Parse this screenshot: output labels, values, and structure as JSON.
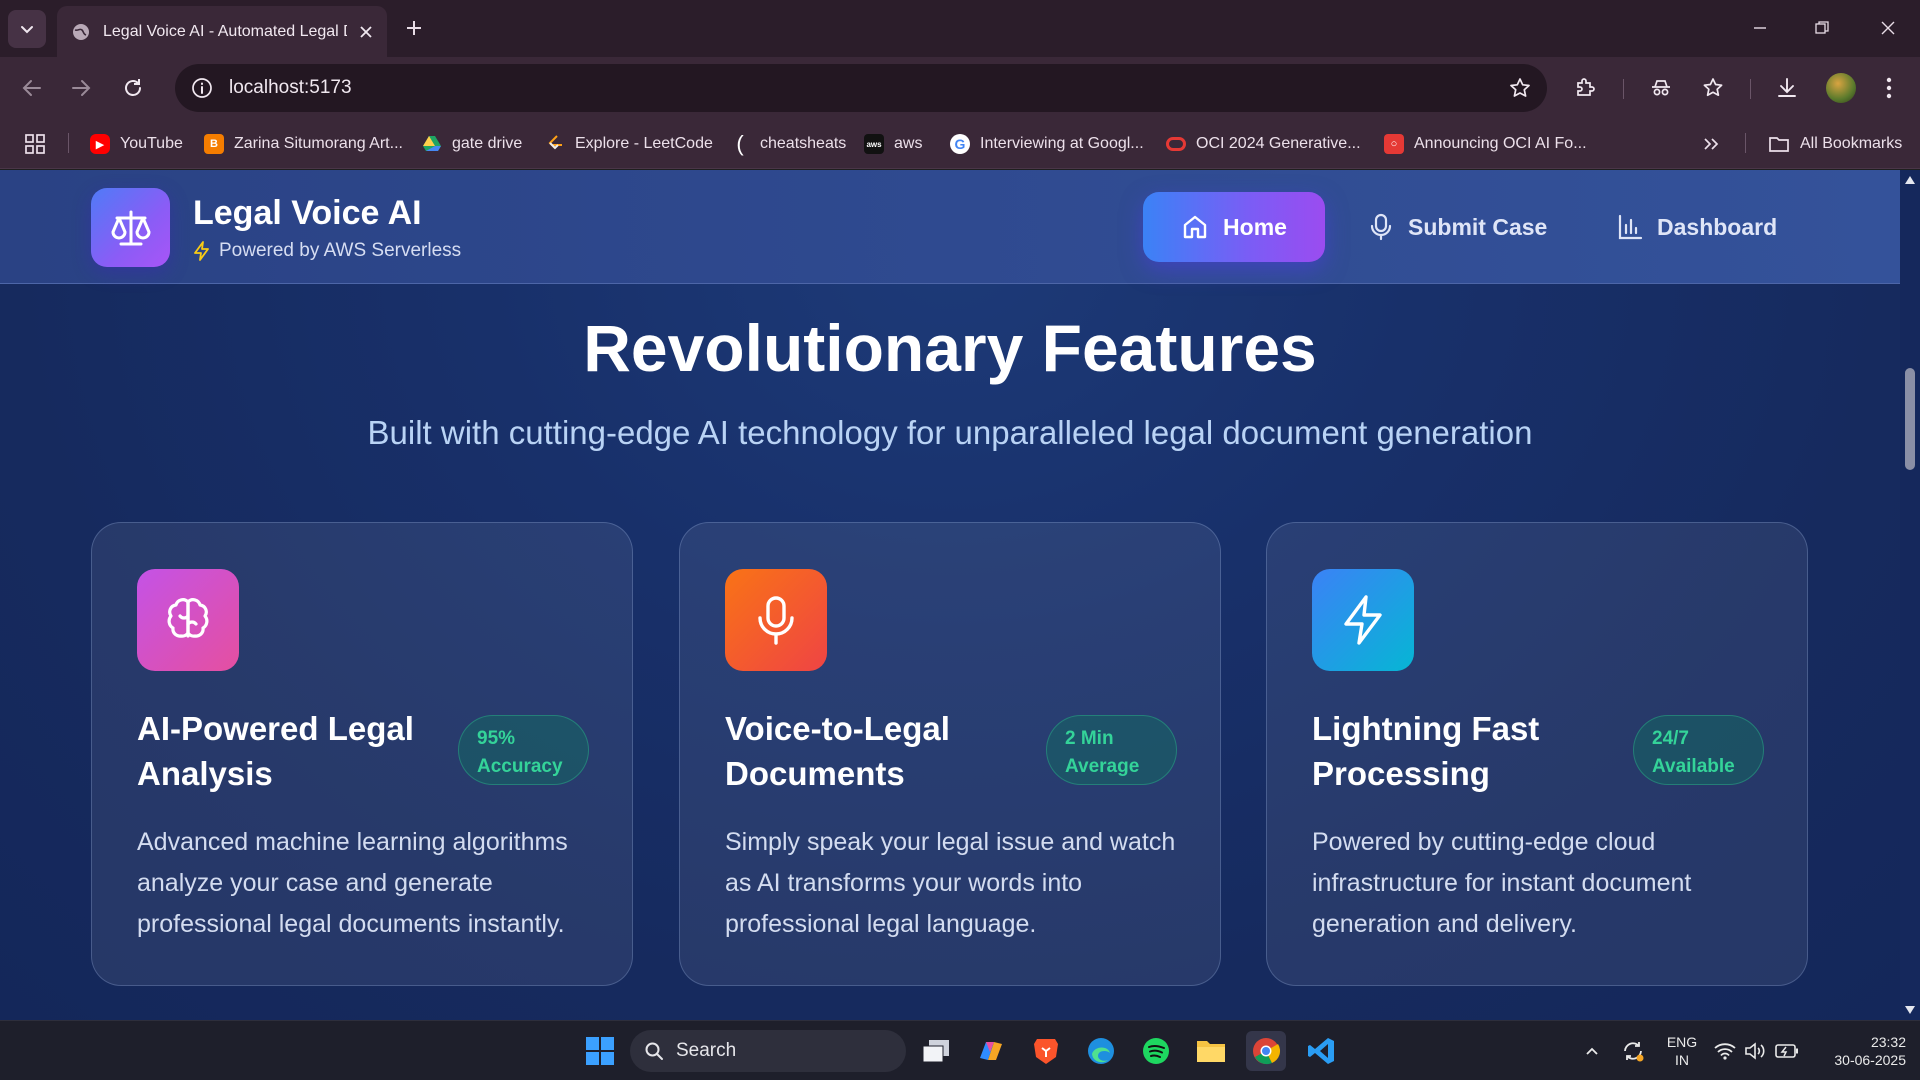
{
  "browser": {
    "tab_title": "Legal Voice AI - Automated Legal D",
    "url": "localhost:5173",
    "bookmarks": [
      {
        "label": "YouTube",
        "icon": "youtube-icon",
        "color": "#ff0000"
      },
      {
        "label": "Zarina Situmorang Art...",
        "icon": "blogger-icon",
        "color": "#f57d00"
      },
      {
        "label": "gate drive",
        "icon": "google-drive-icon",
        "color": "#1fa463"
      },
      {
        "label": "Explore - LeetCode",
        "icon": "leetcode-icon",
        "color": "#ffa116"
      },
      {
        "label": "cheatsheats",
        "icon": "bracket-icon",
        "color": "#ffffff"
      },
      {
        "label": "aws",
        "icon": "aws-icon",
        "color": "#232f3e"
      },
      {
        "label": "Interviewing at Googl...",
        "icon": "google-icon",
        "color": "#4285f4"
      },
      {
        "label": "OCI 2024 Generative...",
        "icon": "oracle-icon",
        "color": "#e53935"
      },
      {
        "label": "Announcing OCI AI Fo...",
        "icon": "oracle-icon",
        "color": "#e53935"
      }
    ],
    "all_bookmarks": "All Bookmarks"
  },
  "header": {
    "brand_title": "Legal Voice AI",
    "brand_subtitle": "Powered by AWS Serverless",
    "nav": {
      "home": "Home",
      "submit_case": "Submit Case",
      "dashboard": "Dashboard"
    }
  },
  "features": {
    "title": "Revolutionary Features",
    "subtitle": "Built with cutting-edge AI technology for unparalleled legal document generation",
    "cards": [
      {
        "icon": "brain-icon",
        "title": "AI-Powered Legal Analysis",
        "badge_line1": "95%",
        "badge_line2": "Accuracy",
        "description": "Advanced machine learning algorithms analyze your case and generate professional legal documents instantly.",
        "gradient": [
          "#c453e6",
          "#e54fa0"
        ]
      },
      {
        "icon": "microphone-icon",
        "title": "Voice-to-Legal Documents",
        "badge_line1": "2 Min",
        "badge_line2": "Average",
        "description": "Simply speak your legal issue and watch as AI transforms your words into professional legal language.",
        "gradient": [
          "#f97316",
          "#ef4444"
        ]
      },
      {
        "icon": "lightning-icon",
        "title": "Lightning Fast Processing",
        "badge_line1": "24/7",
        "badge_line2": "Available",
        "description": "Powered by cutting-edge cloud infrastructure for instant document generation and delivery.",
        "gradient": [
          "#3b82f6",
          "#06b6d4"
        ]
      }
    ]
  },
  "taskbar": {
    "search_label": "Search",
    "language_line1": "ENG",
    "language_line2": "IN",
    "time": "23:32",
    "date": "30-06-2025"
  }
}
